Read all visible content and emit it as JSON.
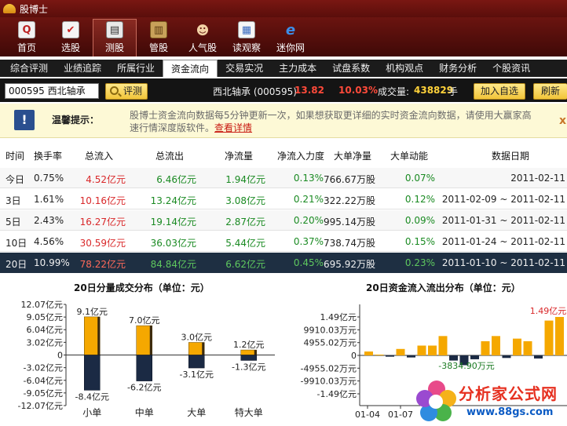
{
  "app": {
    "title": "股博士"
  },
  "toolbar": {
    "items": [
      {
        "label": "首页",
        "icon": "search-doc-icon",
        "active": false
      },
      {
        "label": "选股",
        "icon": "checklist-icon",
        "active": false
      },
      {
        "label": "测股",
        "icon": "measure-icon",
        "active": true
      },
      {
        "label": "管股",
        "icon": "book-icon",
        "active": false
      },
      {
        "label": "人气股",
        "icon": "people-icon",
        "active": false
      },
      {
        "label": "读观察",
        "icon": "report-icon",
        "active": false
      },
      {
        "label": "迷你网",
        "icon": "ie-icon",
        "active": false
      }
    ]
  },
  "tabs": [
    {
      "label": "综合评测",
      "active": false
    },
    {
      "label": "业绩追踪",
      "active": false
    },
    {
      "label": "所属行业",
      "active": false
    },
    {
      "label": "资金流向",
      "active": true
    },
    {
      "label": "交易实况",
      "active": false
    },
    {
      "label": "主力成本",
      "active": false
    },
    {
      "label": "试盘系数",
      "active": false
    },
    {
      "label": "机构观点",
      "active": false
    },
    {
      "label": "财务分析",
      "active": false
    },
    {
      "label": "个股资讯",
      "active": false
    }
  ],
  "search": {
    "code_value": "000595   西北轴承",
    "eval_label": "评测"
  },
  "quote": {
    "name": "西北轴承 (000595)",
    "price": "13.82",
    "change": "10.03%",
    "volume_label": "成交量:",
    "volume": "438829",
    "volume_unit": "手"
  },
  "buttons": {
    "add_watch": "加入自选",
    "refresh": "刷新"
  },
  "notice": {
    "title": "温馨提示：",
    "text": "股博士资金流向数据每5分钟更新一次，如果想获取更详细的实时资金流向数据，请使用大赢家高速行情深度版软件。",
    "link": "查看详情",
    "close": "x"
  },
  "table": {
    "headers": [
      "时间",
      "换手率",
      "总流入",
      "总流出",
      "净流量",
      "净流入力度",
      "大单净量",
      "大单动能",
      "数据日期"
    ],
    "rows": [
      [
        "今日",
        "0.75%",
        "4.52亿元",
        "6.46亿元",
        "1.94亿元",
        "0.13%",
        "766.67万股",
        "0.07%",
        "2011-02-11"
      ],
      [
        "3日",
        "1.61%",
        "10.16亿元",
        "13.24亿元",
        "3.08亿元",
        "0.21%",
        "322.22万股",
        "0.12%",
        "2011-02-09 ~ 2011-02-11"
      ],
      [
        "5日",
        "2.43%",
        "16.27亿元",
        "19.14亿元",
        "2.87亿元",
        "0.20%",
        "995.14万股",
        "0.09%",
        "2011-01-31 ~ 2011-02-11"
      ],
      [
        "10日",
        "4.56%",
        "30.59亿元",
        "36.03亿元",
        "5.44亿元",
        "0.37%",
        "738.74万股",
        "0.15%",
        "2011-01-24 ~ 2011-02-11"
      ],
      [
        "20日",
        "10.99%",
        "78.22亿元",
        "84.84亿元",
        "6.62亿元",
        "0.45%",
        "695.92万股",
        "0.23%",
        "2011-01-10 ~ 2011-02-11"
      ]
    ]
  },
  "colors": {
    "inflow": "#f5a800",
    "outflow": "#1b2a44",
    "accent": "#d9282a",
    "positive": "#1a8a22"
  },
  "chart_data": [
    {
      "type": "bar",
      "title": "20日分量成交分布（单位：元）",
      "categories": [
        "小单",
        "中单",
        "大单",
        "特大单"
      ],
      "series": [
        {
          "values": [
            9.1,
            7.0,
            3.0,
            1.2
          ],
          "labels": [
            "9.1亿元",
            "7.0亿元",
            "3.0亿元",
            "1.2亿元"
          ]
        },
        {
          "values": [
            -8.4,
            -6.2,
            -3.1,
            -1.3
          ],
          "labels": [
            "-8.4亿元",
            "-6.2亿元",
            "-3.1亿元",
            "-1.3亿元"
          ]
        }
      ],
      "yticks": [
        12.07,
        9.05,
        6.04,
        3.02,
        0,
        -3.02,
        -6.04,
        -9.05,
        -12.07
      ],
      "ytick_labels": [
        "12.07亿元",
        "9.05亿元",
        "6.04亿元",
        "3.02亿元",
        "0",
        "-3.02亿元",
        "-6.04亿元",
        "-9.05亿元",
        "-12.07亿元"
      ],
      "ylim": [
        -12.07,
        12.07
      ]
    },
    {
      "type": "bar",
      "title": "20日资金流入流出分布（单位：元）",
      "x_labels": [
        "01-04",
        "01-07"
      ],
      "values": [
        0.15,
        0.03,
        -0.05,
        0.25,
        -0.08,
        0.38,
        0.38,
        0.75,
        -0.2,
        -0.38,
        -0.15,
        0.55,
        0.75,
        -0.1,
        0.65,
        0.55,
        -0.12,
        1.35,
        1.49
      ],
      "yticks": [
        1.49,
        0.991,
        0.4955,
        0,
        -0.4955,
        -0.991,
        -1.49
      ],
      "ytick_labels": [
        "1.49亿元",
        "9910.03万元",
        "4955.02万元",
        "0",
        "-4955.02万元",
        "-9910.03万元",
        "-1.49亿元"
      ],
      "annotations": [
        "1.49亿元",
        "-3834.90万元"
      ],
      "ylim": [
        -1.49,
        1.49
      ]
    }
  ],
  "watermark": {
    "text": "分析家公式网",
    "url": "www.88gs.com"
  }
}
